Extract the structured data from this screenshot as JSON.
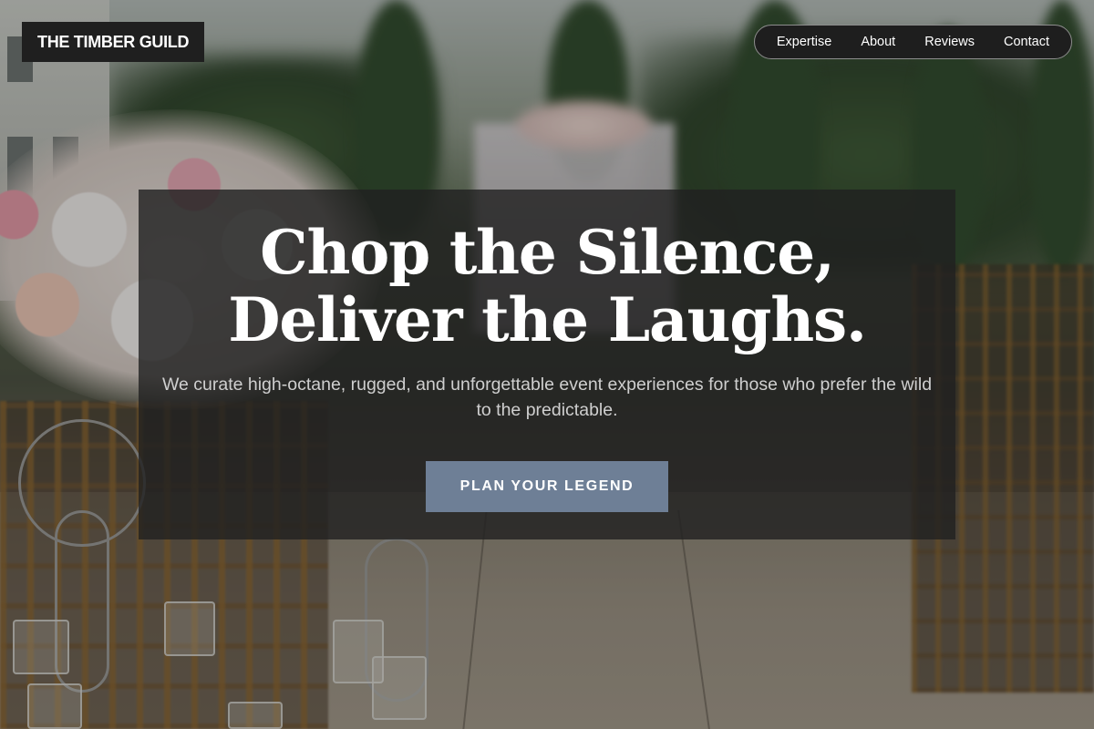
{
  "brand": {
    "name": "THE TIMBER GUILD"
  },
  "nav": {
    "items": [
      {
        "label": "Expertise"
      },
      {
        "label": "About"
      },
      {
        "label": "Reviews"
      },
      {
        "label": "Contact"
      }
    ]
  },
  "hero": {
    "headline": "Chop the Silence, Deliver the Laughs.",
    "subtext": "We curate high-octane, rugged, and unforgettable event experiences for those who prefer the wild to the predictable.",
    "cta_label": "PLAN YOUR LEGEND"
  },
  "colors": {
    "accent": "#6e7f96",
    "panel": "#1f1f1f"
  }
}
